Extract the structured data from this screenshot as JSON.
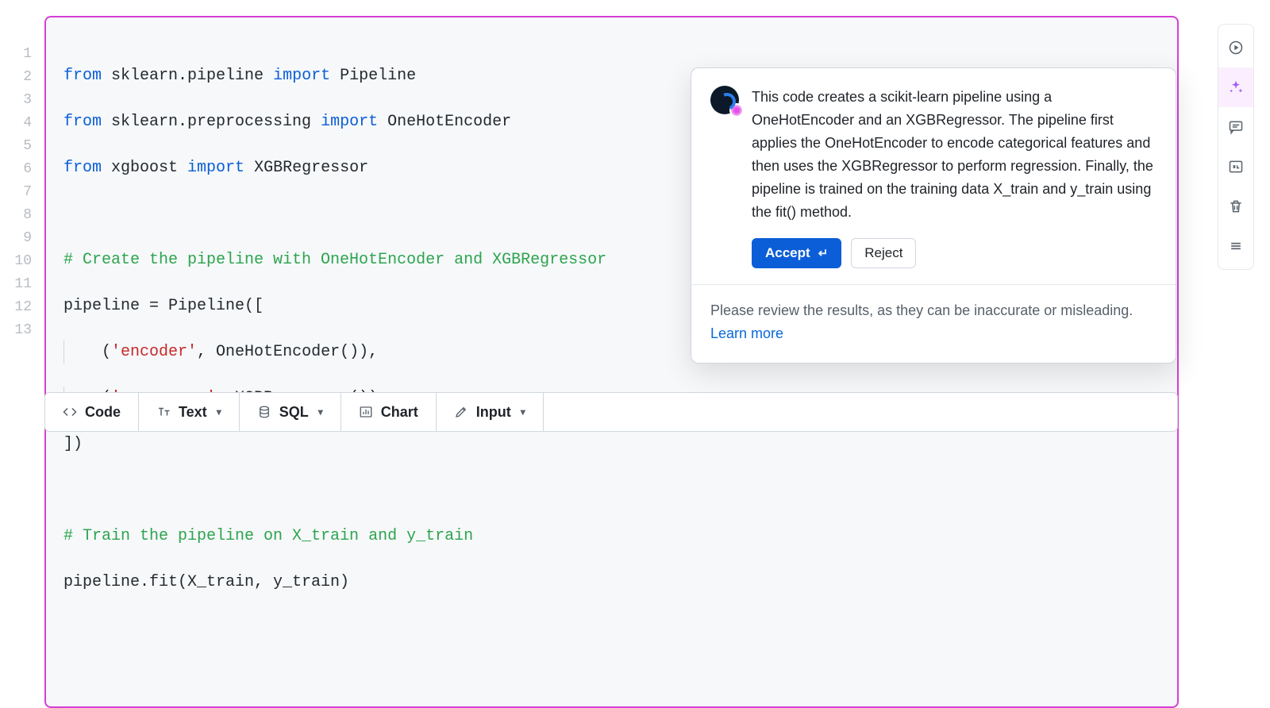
{
  "code": {
    "line_numbers": [
      "1",
      "2",
      "3",
      "4",
      "5",
      "6",
      "7",
      "8",
      "9",
      "10",
      "11",
      "12",
      "13"
    ],
    "tokens": {
      "kw_from": "from",
      "kw_import": "import",
      "l1_mod": " sklearn.pipeline ",
      "l1_name": " Pipeline",
      "l2_mod": " sklearn.preprocessing ",
      "l2_name": " OneHotEncoder",
      "l3_mod": " xgboost ",
      "l3_name": " XGBRegressor",
      "c1": "# Create the pipeline with OneHotEncoder and XGBRegressor",
      "l6": "pipeline = Pipeline([",
      "l7_pre": "    (",
      "l7_str": "'encoder'",
      "l7_post": ", OneHotEncoder()),",
      "l8_pre": "    (",
      "l8_str": "'regressor'",
      "l8_post": ", XGBRegressor())",
      "l9": "])",
      "c2": "# Train the pipeline on X_train and y_train",
      "l12": "pipeline.fit(X_train, y_train)"
    }
  },
  "popover": {
    "explanation": "This code creates a scikit-learn pipeline using a OneHotEncoder and an XGBRegressor. The pipeline first applies the OneHotEncoder to encode categorical features and then uses the XGBRegressor to perform regression. Finally, the pipeline is trained on the training data X_train and y_train using the fit() method.",
    "accept_label": "Accept",
    "reject_label": "Reject",
    "footer_text": "Please review the results, as they can be inaccurate or misleading. ",
    "learn_more": "Learn more"
  },
  "toolbar": {
    "code": "Code",
    "text": "Text",
    "sql": "SQL",
    "chart": "Chart",
    "input": "Input"
  }
}
